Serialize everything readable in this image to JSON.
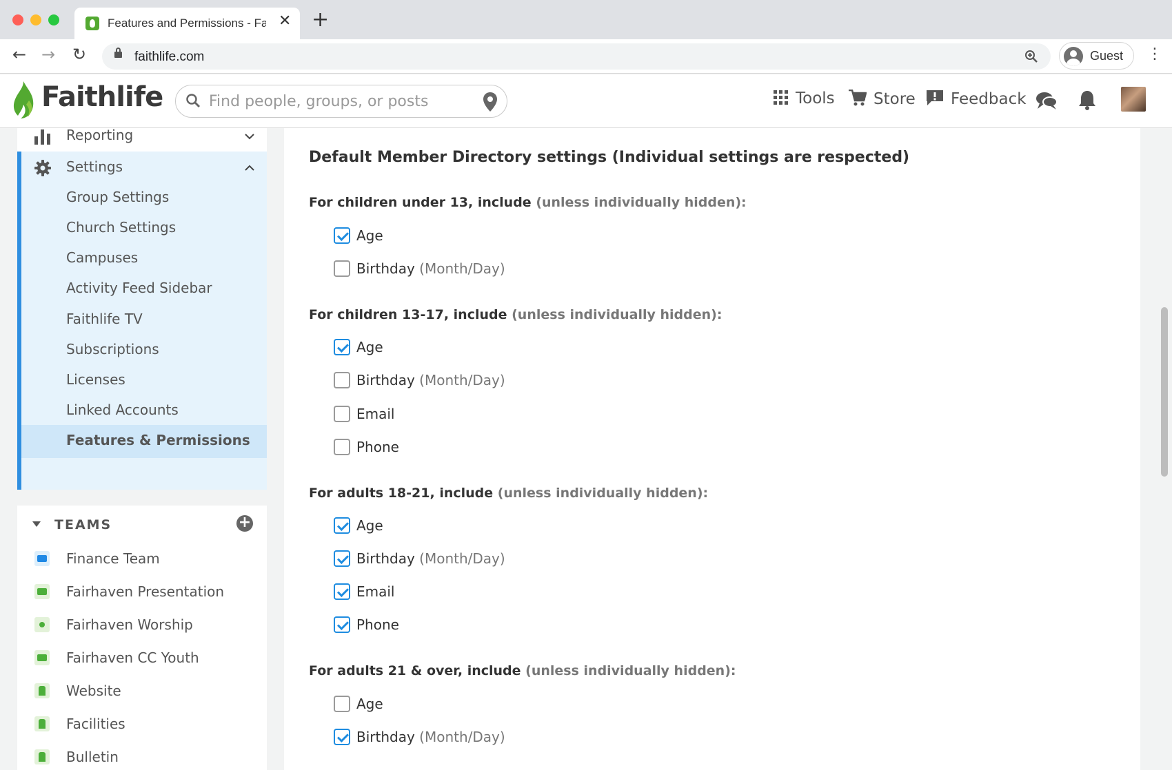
{
  "browser": {
    "tab_title": "Features and Permissions - Faithlife",
    "url": "faithlife.com",
    "profile_label": "Guest"
  },
  "header": {
    "brand": "Faithlife",
    "search_placeholder": "Find people, groups, or posts",
    "nav": {
      "tools": "Tools",
      "store": "Store",
      "feedback": "Feedback"
    }
  },
  "sidebar": {
    "reporting": "Reporting",
    "settings": "Settings",
    "settings_items": [
      "Group Settings",
      "Church Settings",
      "Campuses",
      "Activity Feed Sidebar",
      "Faithlife TV",
      "Subscriptions",
      "Licenses",
      "Linked Accounts",
      "Features & Permissions"
    ],
    "teams_title": "TEAMS",
    "teams": [
      "Finance Team",
      "Fairhaven Presentation",
      "Fairhaven Worship",
      "Fairhaven CC Youth",
      "Website",
      "Facilities",
      "Bulletin"
    ]
  },
  "main": {
    "title": "Default Member Directory settings (Individual settings are respected)",
    "qualifier": "(unless individually hidden):",
    "date_hint": "(Month/Day)",
    "groups": [
      {
        "label": "For children under 13, include",
        "options": [
          {
            "label": "Age",
            "checked": true
          },
          {
            "label": "Birthday",
            "checked": false
          }
        ]
      },
      {
        "label": "For children 13-17, include",
        "options": [
          {
            "label": "Age",
            "checked": true
          },
          {
            "label": "Birthday",
            "checked": false
          },
          {
            "label": "Email",
            "checked": false
          },
          {
            "label": "Phone",
            "checked": false
          }
        ]
      },
      {
        "label": "For adults 18-21, include",
        "options": [
          {
            "label": "Age",
            "checked": true
          },
          {
            "label": "Birthday",
            "checked": true
          },
          {
            "label": "Email",
            "checked": true
          },
          {
            "label": "Phone",
            "checked": true
          }
        ]
      },
      {
        "label": "For adults 21 & over, include",
        "options": [
          {
            "label": "Age",
            "checked": false
          },
          {
            "label": "Birthday",
            "checked": true
          }
        ]
      }
    ]
  },
  "colors": {
    "accent": "#1e8ce0",
    "brand_green": "#53a931",
    "sidebar_active_bg": "#cfe7f9"
  }
}
